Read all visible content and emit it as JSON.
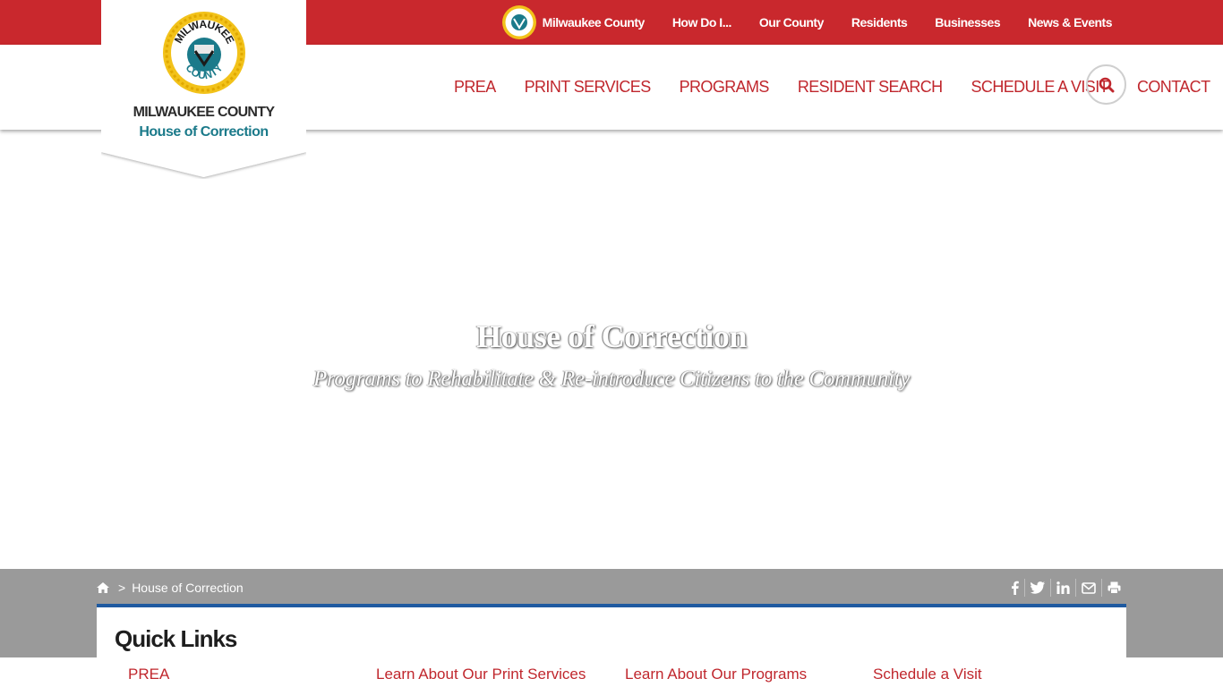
{
  "colors": {
    "brand_red": "#c9282d",
    "accent_teal": "#1b7a8a",
    "panel_border_blue": "#1f5aa0",
    "breadcrumb_gray": "#9a9a9a"
  },
  "topbar": {
    "links": [
      "Milwaukee County",
      "How Do I...",
      "Our County",
      "Residents",
      "Businesses",
      "News & Events"
    ]
  },
  "logo": {
    "line1": "MILWAUKEE COUNTY",
    "line2": "House of Correction",
    "seal_text_top": "MILWAUKEE",
    "seal_text_bottom": "COUNTY"
  },
  "mainnav": {
    "items": [
      "PREA",
      "PRINT SERVICES",
      "PROGRAMS",
      "RESIDENT SEARCH",
      "SCHEDULE A VISIT",
      "CONTACT"
    ],
    "search_icon": "search-icon"
  },
  "hero": {
    "title": "House of Correction",
    "subtitle": "Programs to Rehabilitate & Re-introduce Citizens to the Community"
  },
  "breadcrumb": {
    "home_icon": "home-icon",
    "separator": ">",
    "current": "House of Correction"
  },
  "share_icons": [
    "facebook-icon",
    "twitter-icon",
    "linkedin-icon",
    "email-icon",
    "print-icon"
  ],
  "quicklinks": {
    "title": "Quick Links",
    "items": [
      "PREA",
      "Learn About Our Print Services",
      "Learn About Our Programs",
      "Schedule a Visit"
    ]
  }
}
